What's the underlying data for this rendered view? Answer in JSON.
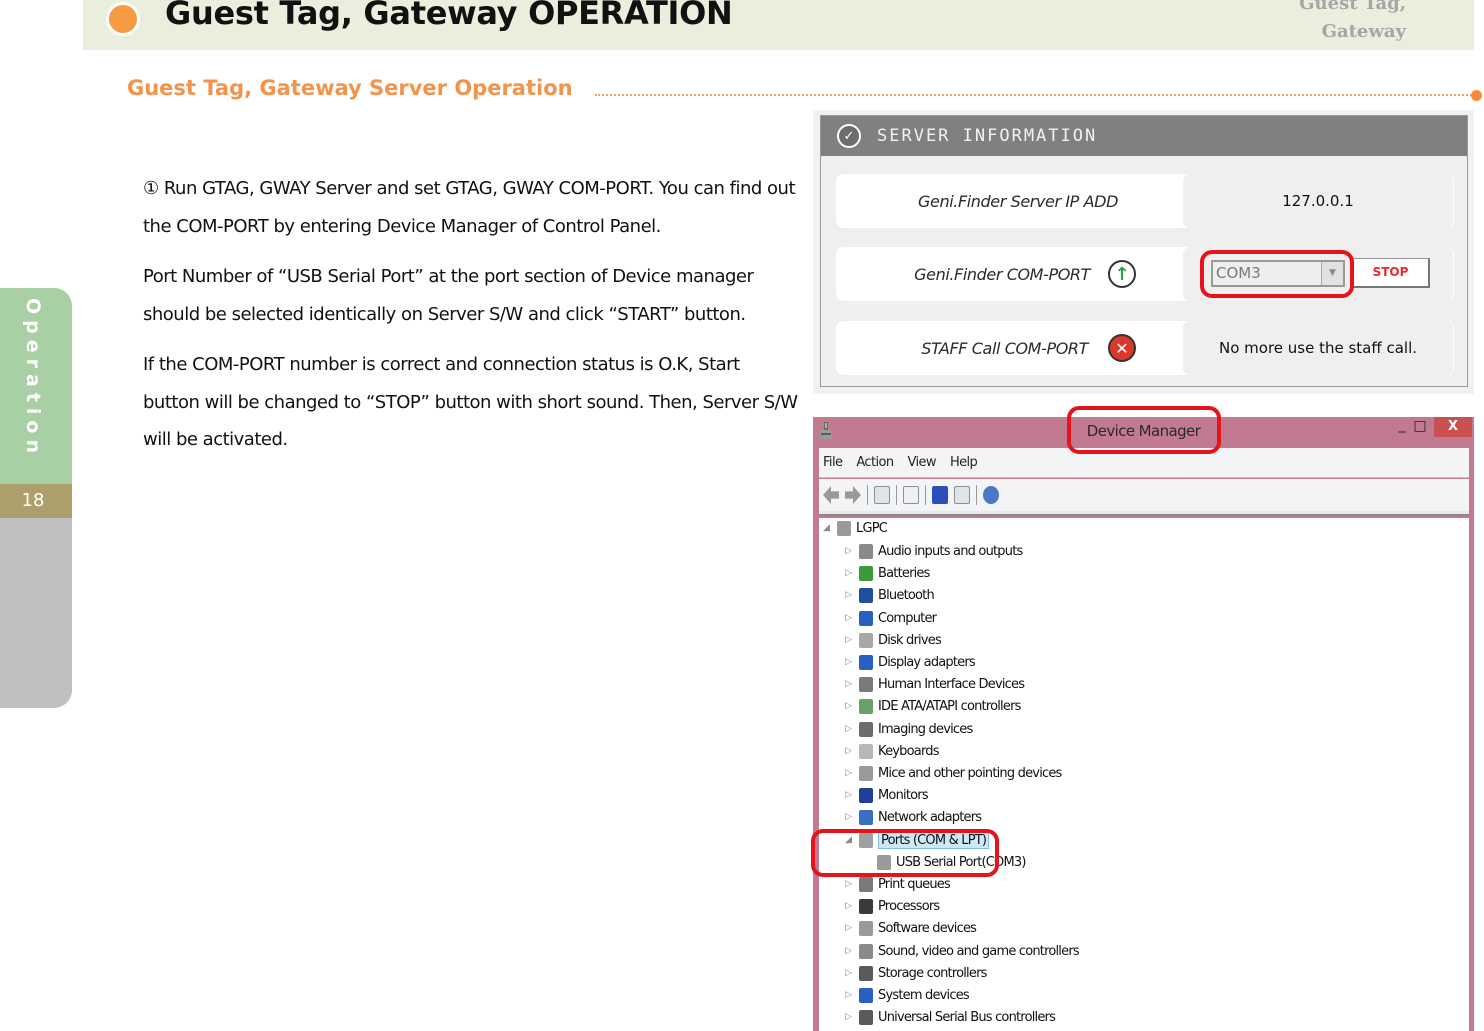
{
  "header": {
    "title": "Guest Tag, Gateway OPERATION",
    "right_label_line1": "Guest Tag,",
    "right_label_line2": "Gateway"
  },
  "section": {
    "title": "Guest Tag, Gateway Server Operation"
  },
  "side_tab": {
    "label": "Operation",
    "page_number": "18"
  },
  "body": {
    "paragraphs": [
      "① Run GTAG, GWAY Server and set GTAG, GWAY COM-PORT. You can find out the COM-PORT by entering Device Manager of Control Panel.",
      "Port Number of “USB Serial Port” at the port section of Device manager should be selected identically on Server S/W and click “START” button.",
      " If the COM-PORT number is correct and connection status is O.K, Start button will be changed to “STOP” button with short sound. Then, Server S/W will be activated."
    ]
  },
  "server_info": {
    "title": "SERVER INFORMATION",
    "rows": [
      {
        "label": "Geni.Finder Server IP ADD",
        "value": "127.0.0.1"
      },
      {
        "label": "Geni.Finder COM-PORT",
        "status_icon": "green-up-arrow-icon",
        "port_value": "COM3",
        "button_label": "STOP"
      },
      {
        "label": "STAFF Call COM-PORT",
        "status_icon": "red-x-icon",
        "value": "No more use the staff call."
      }
    ]
  },
  "device_manager": {
    "title": "Device Manager",
    "window_controls": {
      "minimize": "_",
      "maximize": "□",
      "close": "X"
    },
    "menu": [
      "File",
      "Action",
      "View",
      "Help"
    ],
    "tree_root": "LGPC",
    "tree_items": [
      "Audio inputs and outputs",
      "Batteries",
      "Bluetooth",
      "Computer",
      "Disk drives",
      "Display adapters",
      "Human Interface Devices",
      "IDE ATA/ATAPI controllers",
      "Imaging devices",
      "Keyboards",
      "Mice and other pointing devices",
      "Monitors",
      "Network adapters",
      "Ports (COM & LPT)",
      "USB Serial Port(COM3)",
      "Print queues",
      "Processors",
      "Software devices",
      "Sound, video and game controllers",
      "Storage controllers",
      "System devices",
      "Universal Serial Bus controllers"
    ]
  },
  "colors": {
    "accent_orange": "#f4934a",
    "highlight_red": "#e5141c",
    "side_green": "#a9d0a4",
    "side_page": "#ac9f6b",
    "window_frame": "#c27a92"
  }
}
